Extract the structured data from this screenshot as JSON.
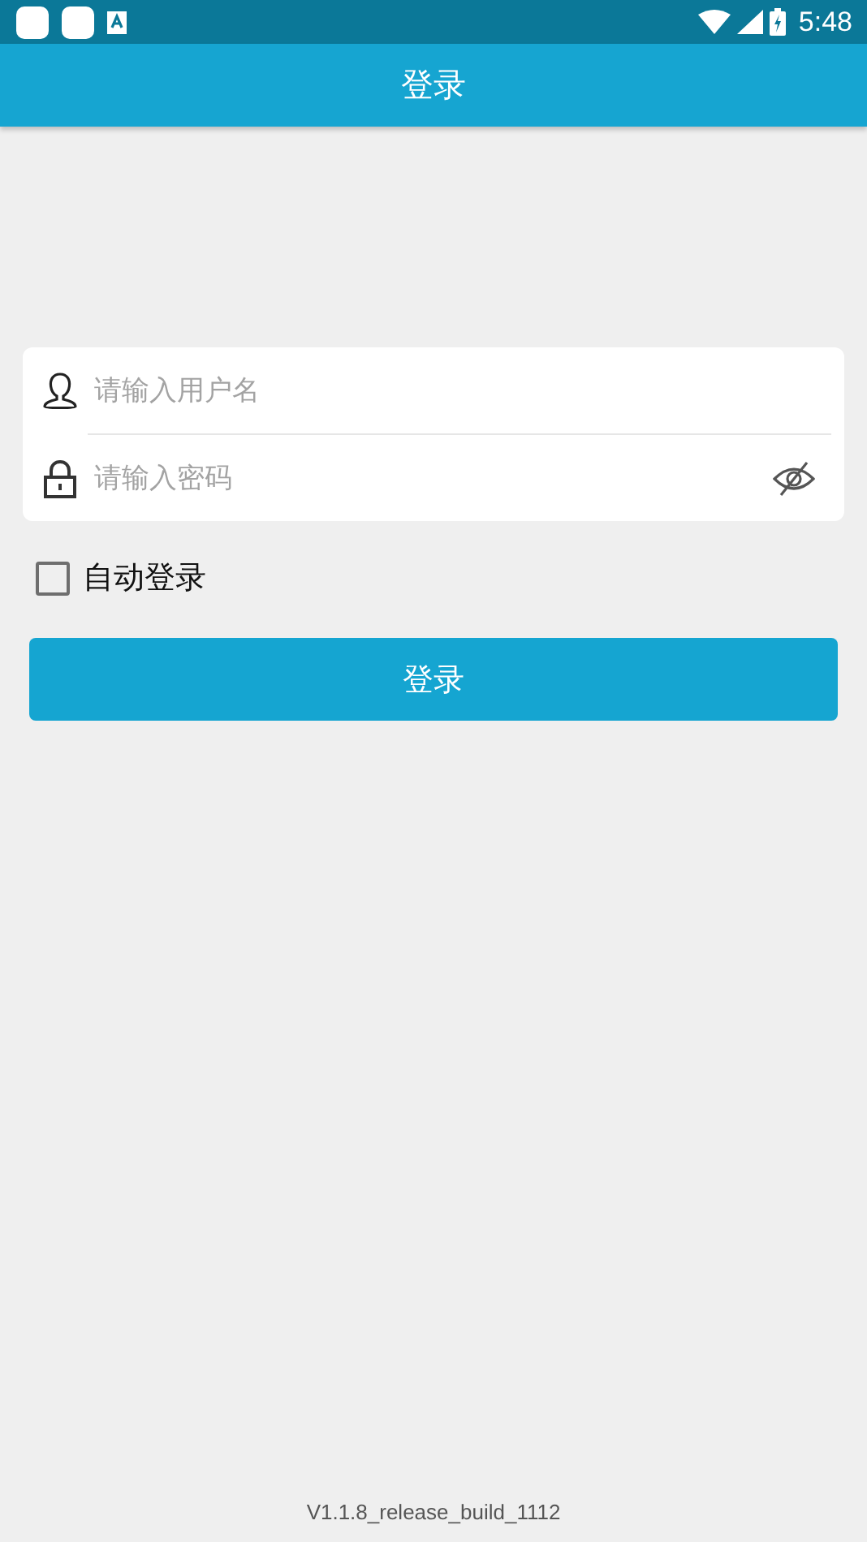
{
  "status_bar": {
    "time": "5:48"
  },
  "app_bar": {
    "title": "登录"
  },
  "form": {
    "username": {
      "placeholder": "请输入用户名"
    },
    "password": {
      "placeholder": "请输入密码",
      "visible": false
    }
  },
  "auto_login": {
    "label": "自动登录",
    "checked": false
  },
  "login_button": {
    "label": "登录"
  },
  "version": "V1.1.8_release_build_1112"
}
